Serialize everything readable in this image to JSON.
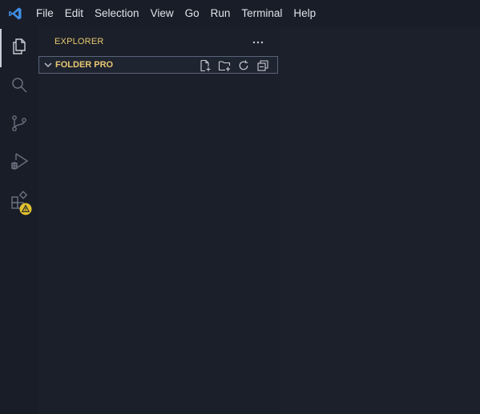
{
  "menu": [
    "File",
    "Edit",
    "Selection",
    "View",
    "Go",
    "Run",
    "Terminal",
    "Help"
  ],
  "activity": {
    "explorer_icon": "files-icon",
    "search_icon": "search-icon",
    "scm_icon": "source-control-icon",
    "debug_icon": "run-debug-icon",
    "extensions_icon": "extensions-icon",
    "warning_icon": "warning-icon"
  },
  "sidebar": {
    "title": "EXPLORER",
    "folder": {
      "name": "FOLDER PRO",
      "actions": [
        "new-file-icon",
        "new-folder-icon",
        "refresh-icon",
        "collapse-all-icon"
      ]
    }
  },
  "colors": {
    "accent_text": "#e8c872",
    "logo_blue": "#3f8ee6",
    "background": "#1b1f29",
    "warning": "#e2c12f"
  }
}
